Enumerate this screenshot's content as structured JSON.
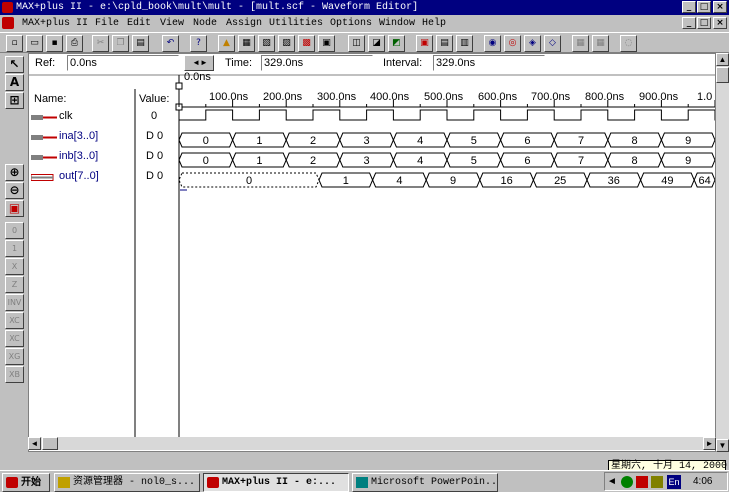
{
  "window": {
    "title": "MAX+plus II - e:\\cpld_book\\mult\\mult - [mult.scf - Waveform Editor]",
    "controls": [
      "_",
      "□",
      "×"
    ]
  },
  "menubar": {
    "items": [
      "MAX+plus II",
      "File",
      "Edit",
      "View",
      "Node",
      "Assign",
      "Utilities",
      "Options",
      "Window",
      "Help"
    ],
    "child_controls": [
      "_",
      "□",
      "×"
    ]
  },
  "toolbar": {
    "icons": [
      "new-icon",
      "open-icon",
      "save-icon",
      "print-icon",
      "cut-icon",
      "copy-icon",
      "paste-icon",
      "undo-icon",
      "help-pointer-icon",
      "hierarchy-up-icon",
      "floorplan-icon",
      "save-compile-icon",
      "save-simulate-icon",
      "compiler-icon",
      "simulator-icon",
      "timing-analyzer-icon",
      "programmer-icon",
      "open-file-icon",
      "find-node-icon",
      "find-next-icon",
      "report-icon",
      "message-icon",
      "waveform-icon",
      "project-icon",
      "text-editor-icon",
      "graphic-editor-icon",
      "symbol-editor-icon",
      "fit-window-icon",
      "zoom-region-icon",
      "zoom-search-icon"
    ]
  },
  "refbar": {
    "ref_label": "Ref:",
    "ref_value": "0.0ns",
    "time_label": "Time:",
    "time_value": "329.0ns",
    "interval_label": "Interval:",
    "interval_value": "329.0ns"
  },
  "columns": {
    "name_header": "Name:",
    "value_header": "Value:",
    "cursor_time": "0.0ns"
  },
  "ruler": [
    "100.0ns",
    "200.0ns",
    "300.0ns",
    "400.0ns",
    "500.0ns",
    "600.0ns",
    "700.0ns",
    "800.0ns",
    "900.0ns",
    "1.0"
  ],
  "signals": [
    {
      "name": "clk",
      "value": "0",
      "values": []
    },
    {
      "name": "ina[3..0]",
      "value": "D 0",
      "values": [
        "0",
        "1",
        "2",
        "3",
        "4",
        "5",
        "6",
        "7",
        "8",
        "9"
      ]
    },
    {
      "name": "inb[3..0]",
      "value": "D 0",
      "values": [
        "0",
        "1",
        "2",
        "3",
        "4",
        "5",
        "6",
        "7",
        "8",
        "9"
      ]
    },
    {
      "name": "out[7..0]",
      "value": "D 0",
      "values": [
        "0",
        "1",
        "4",
        "9",
        "16",
        "25",
        "36",
        "49",
        "64"
      ]
    }
  ],
  "lefttools": [
    "selection-tool-icon",
    "text-tool-icon",
    "waveform-select-icon",
    "zoom-in-icon",
    "zoom-out-icon",
    "fit-icon",
    "zero-icon",
    "one-icon",
    "undefined-x-icon",
    "high-z-icon",
    "invert-icon",
    "count-value-icon",
    "clock-value-icon",
    "group-value-icon",
    "multiply-value-icon"
  ],
  "lefttool_labels": [
    "0",
    "1",
    "X",
    "Z",
    "INV",
    "XC",
    "XC",
    "XG",
    "XB"
  ],
  "taskbar": {
    "start_label": "开始",
    "tasks": [
      {
        "label": "资源管理器 - nol0_s...",
        "active": false
      },
      {
        "label": "MAX+plus II - e:...",
        "active": true
      },
      {
        "label": "Microsoft PowerPoin...",
        "active": false
      }
    ],
    "tray_lang": "En",
    "clock": "4:06",
    "date_tooltip": "星期六, 十月 14, 2000"
  }
}
